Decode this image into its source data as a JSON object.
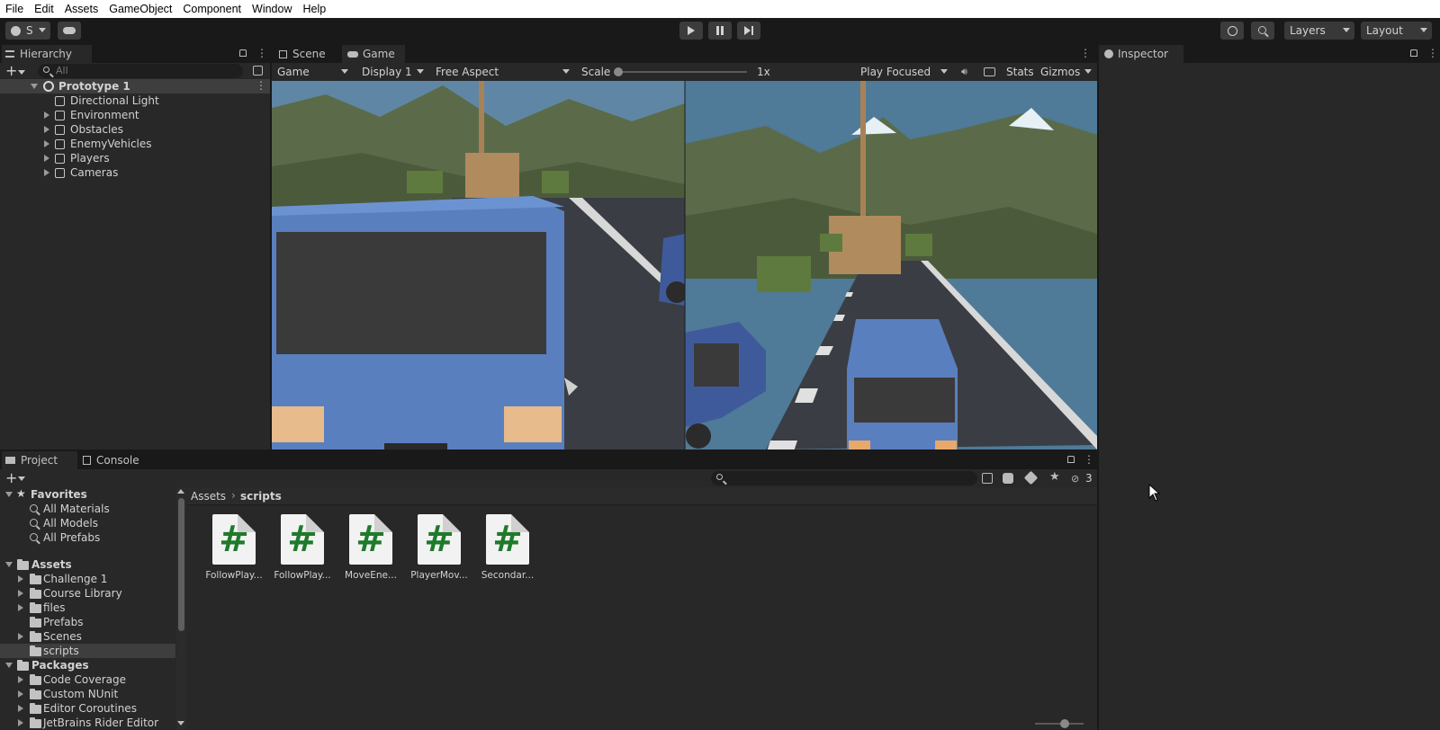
{
  "menu": [
    "File",
    "Edit",
    "Assets",
    "GameObject",
    "Component",
    "Window",
    "Help"
  ],
  "toolbar": {
    "account_label": "S",
    "layers_label": "Layers",
    "layout_label": "Layout"
  },
  "hierarchy": {
    "tab_label": "Hierarchy",
    "search_placeholder": "All",
    "scene_name": "Prototype 1",
    "items": [
      {
        "label": "Directional Light",
        "expandable": false
      },
      {
        "label": "Environment",
        "expandable": true
      },
      {
        "label": "Obstacles",
        "expandable": true
      },
      {
        "label": "EnemyVehicles",
        "expandable": true
      },
      {
        "label": "Players",
        "expandable": true
      },
      {
        "label": "Cameras",
        "expandable": true
      }
    ]
  },
  "game_view": {
    "tabs": [
      "Scene",
      "Game"
    ],
    "active_tab": "Game",
    "mode_dropdown": "Game",
    "display_dropdown": "Display 1",
    "aspect_dropdown": "Free Aspect",
    "scale_label": "Scale",
    "scale_value": "1x",
    "play_mode_dropdown": "Play Focused",
    "stats_label": "Stats",
    "gizmos_label": "Gizmos"
  },
  "inspector": {
    "tab_label": "Inspector"
  },
  "project": {
    "tabs": [
      "Project",
      "Console"
    ],
    "active_tab": "Project",
    "hidden_count": "3",
    "favorites_label": "Favorites",
    "favorites": [
      "All Materials",
      "All Models",
      "All Prefabs"
    ],
    "assets_label": "Assets",
    "assets_folders": [
      {
        "label": "Challenge 1",
        "expandable": true
      },
      {
        "label": "Course Library",
        "expandable": true
      },
      {
        "label": "files",
        "expandable": true
      },
      {
        "label": "Prefabs",
        "expandable": false
      },
      {
        "label": "Scenes",
        "expandable": true
      },
      {
        "label": "scripts",
        "expandable": false,
        "selected": true
      }
    ],
    "packages_label": "Packages",
    "packages": [
      "Code Coverage",
      "Custom NUnit",
      "Editor Coroutines",
      "JetBrains Rider Editor"
    ],
    "breadcrumb": [
      "Assets",
      "scripts"
    ],
    "files": [
      "FollowPlay...",
      "FollowPlay...",
      "MoveEne...",
      "PlayerMov...",
      "Secondar..."
    ]
  },
  "colors": {
    "menubar_bg": "#ffffff",
    "editor_bg": "#191919",
    "panel_bg": "#282828",
    "selection": "#3e3e3e",
    "script_hash": "#1f7a2c"
  }
}
